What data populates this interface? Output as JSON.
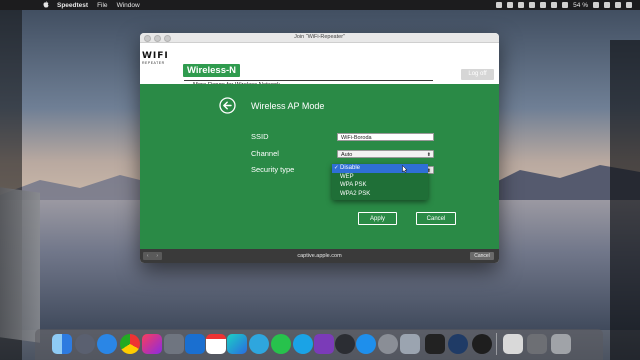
{
  "menubar": {
    "app_name": "Speedtest",
    "items": [
      "File",
      "Window"
    ],
    "battery": "54 %"
  },
  "window": {
    "title": "Join “WiFi-Repeater”",
    "logo_text": "WIFI",
    "logo_subtext": "REPEATER",
    "brand": "Wireless-N",
    "tagline": "More Range for Wireless Network",
    "logoff_label": "Log off",
    "page_title": "Wireless AP Mode",
    "form": {
      "ssid_label": "SSID",
      "ssid_value": "WiFi-Boroda",
      "channel_label": "Channel",
      "channel_value": "Auto",
      "security_label": "Security type",
      "security_options": [
        "Disable",
        "WEP",
        "WPA  PSK",
        "WPA2  PSK"
      ],
      "security_selected": "Disable"
    },
    "apply_label": "Apply",
    "cancel_label": "Cancel",
    "footer": {
      "url": "captive.apple.com",
      "cancel_label": "Cancel"
    }
  },
  "dock": {
    "icons": [
      "finder-icon",
      "launchpad-icon",
      "safari-icon",
      "chrome-icon",
      "intellij-icon",
      "keychain-icon",
      "outlook-icon",
      "calendar-icon",
      "webstorm-icon",
      "telegram-icon",
      "whatsapp-icon",
      "tasks-icon",
      "onenote-icon",
      "speedtest-icon",
      "appstore-icon",
      "systemprefs-icon",
      "preview-icon",
      "terminal-icon",
      "edge-icon",
      "activity-monitor-icon",
      "screenshot-icon",
      "photos-icon",
      "trash-icon"
    ]
  },
  "colors": {
    "page_green": "#2a8a46",
    "brand_green": "#2f9b4e",
    "selection_blue": "#2f6fd6"
  }
}
